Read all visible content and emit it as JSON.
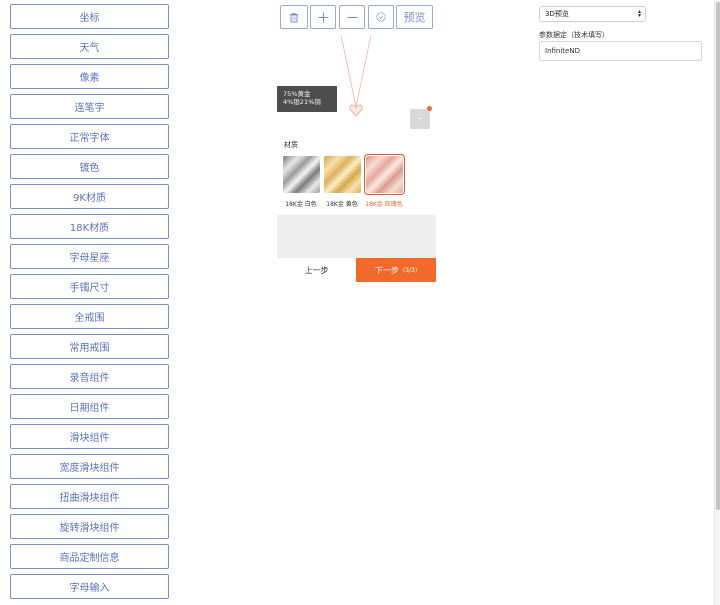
{
  "components": [
    "坐标",
    "天气",
    "像素",
    "连笔字",
    "正常字体",
    "镀色",
    "9K材质",
    "18K材质",
    "字母星座",
    "手镯尺寸",
    "全戒围",
    "常用戒围",
    "录音组件",
    "日期组件",
    "滑块组件",
    "宽度滑块组件",
    "扭曲滑块组件",
    "旋转滑块组件",
    "商品定制信息",
    "字母输入"
  ],
  "toolbar": {
    "delete_icon": "trash-icon",
    "add_icon": "plus-icon",
    "remove_icon": "minus-icon",
    "confirm_icon": "check-circle-icon",
    "preview_label": "预览"
  },
  "preview": {
    "alloy_line1": "75%黄金",
    "alloy_line2": "4%银21%铜",
    "material_title": "材质",
    "materials": [
      {
        "label": "18K金 白色",
        "colors": [
          "#7a7a7a",
          "#e8e8e8",
          "#9c9c9c",
          "#f4f4f4"
        ],
        "selected": false
      },
      {
        "label": "18K金 黄色",
        "colors": [
          "#d6a64e",
          "#f7e2a8",
          "#dcb060",
          "#fbeec4"
        ],
        "selected": false
      },
      {
        "label": "18K金 玫瑰色",
        "colors": [
          "#d99a8e",
          "#f8dcd4",
          "#e2a99b",
          "#fae8e2"
        ],
        "selected": true
      }
    ],
    "prev_label": "上一步",
    "next_label": "下一步",
    "step_count": "(3/3)",
    "accent_color": "#f16a2b"
  },
  "settings": {
    "mode_select": "3D预览",
    "param_label": "参数据定（技术填写）",
    "param_value": "InfiniteND"
  }
}
